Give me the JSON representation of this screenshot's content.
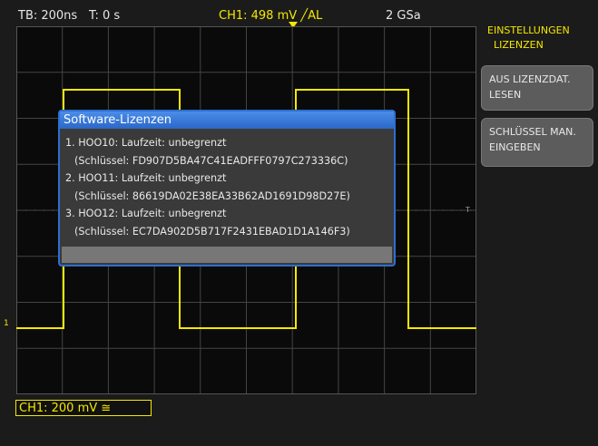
{
  "status": {
    "timebase": "TB: 200ns",
    "trigger_time": "T: 0 s",
    "channel": "CH1: 498 mV ╱AL",
    "sample_rate": "2 GSa"
  },
  "menu": {
    "title_line1": "EINSTELLUNGEN",
    "title_line2": "LIZENZEN",
    "buttons": [
      {
        "line1": "AUS LIZENZDAT.",
        "line2": "LESEN"
      },
      {
        "line1": "SCHLÜSSEL MAN.",
        "line2": "EINGEBEN"
      }
    ]
  },
  "dialog": {
    "title": "Software-Lizenzen",
    "licenses": [
      {
        "name": "1. HOO10: Laufzeit: unbegrenzt",
        "key": "(Schlüssel: FD907D5BA47C41EADFFF0797C273336C)"
      },
      {
        "name": "2. HOO11: Laufzeit: unbegrenzt",
        "key": "(Schlüssel: 86619DA02E38EA33B62AD1691D98D27E)"
      },
      {
        "name": "3. HOO12: Laufzeit: unbegrenzt",
        "key": "(Schlüssel: EC7DA902D5B717F2431EBAD1D1A146F3)"
      }
    ]
  },
  "channel_box": "CH1: 200 mV ≅",
  "channel_marker": "1",
  "trigger_level_marker": "T",
  "colors": {
    "trace": "#f5e800",
    "dialog_accent": "#2c6fd1"
  }
}
